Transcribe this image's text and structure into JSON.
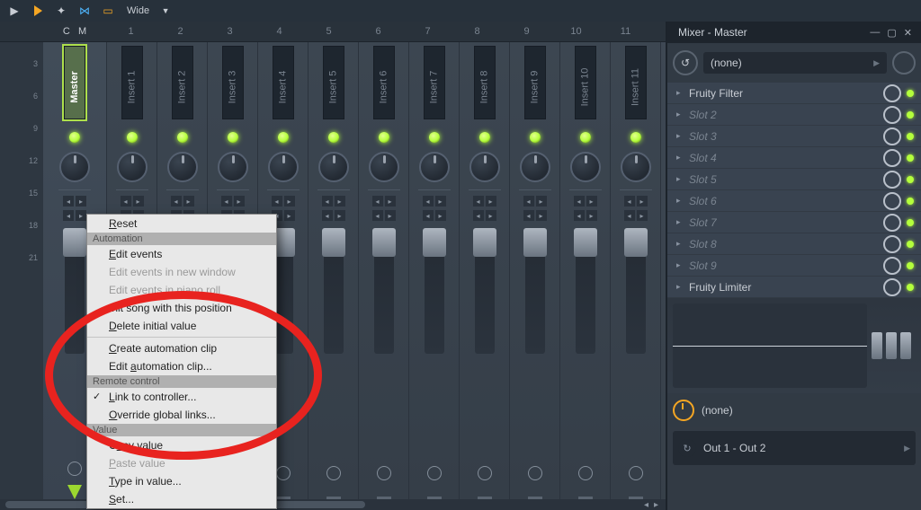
{
  "toolbar": {
    "wide_label": "Wide"
  },
  "headers": {
    "c": "C",
    "m": "M",
    "nums": [
      "1",
      "2",
      "3",
      "4",
      "5",
      "6",
      "7",
      "8",
      "9",
      "10",
      "11"
    ]
  },
  "ruler": [
    "3",
    "6",
    "9",
    "12",
    "15",
    "18",
    "21"
  ],
  "tracks": [
    {
      "name": "Master",
      "master": true
    },
    {
      "name": "Insert 1"
    },
    {
      "name": "Insert 2"
    },
    {
      "name": "Insert 3"
    },
    {
      "name": "Insert 4"
    },
    {
      "name": "Insert 5"
    },
    {
      "name": "Insert 6"
    },
    {
      "name": "Insert 7"
    },
    {
      "name": "Insert 8"
    },
    {
      "name": "Insert 9"
    },
    {
      "name": "Insert 10"
    },
    {
      "name": "Insert 11"
    }
  ],
  "sidepanel": {
    "title": "Mixer - Master",
    "preset": "(none)",
    "slots": [
      {
        "name": "Fruity Filter",
        "filled": true
      },
      {
        "name": "Slot 2",
        "filled": false
      },
      {
        "name": "Slot 3",
        "filled": false
      },
      {
        "name": "Slot 4",
        "filled": false
      },
      {
        "name": "Slot 5",
        "filled": false
      },
      {
        "name": "Slot 6",
        "filled": false
      },
      {
        "name": "Slot 7",
        "filled": false
      },
      {
        "name": "Slot 8",
        "filled": false
      },
      {
        "name": "Slot 9",
        "filled": false
      },
      {
        "name": "Fruity Limiter",
        "filled": true
      }
    ],
    "time_label": "(none)",
    "output_label": "Out 1 - Out 2"
  },
  "context_menu": {
    "items": [
      {
        "type": "item",
        "label": "Reset",
        "u": "R"
      },
      {
        "type": "section",
        "label": "Automation"
      },
      {
        "type": "item",
        "label": "Edit events",
        "u": "E"
      },
      {
        "type": "item",
        "label": "Edit events in new window",
        "disabled": true
      },
      {
        "type": "item",
        "label": "Edit events in piano roll",
        "disabled": true
      },
      {
        "type": "item",
        "label": "Init song with this position"
      },
      {
        "type": "item",
        "label": "Delete initial value",
        "u": "D"
      },
      {
        "type": "sep"
      },
      {
        "type": "item",
        "label": "Create automation clip",
        "u": "C"
      },
      {
        "type": "item",
        "label": "Edit automation clip...",
        "u": "a"
      },
      {
        "type": "section",
        "label": "Remote control"
      },
      {
        "type": "item",
        "label": "Link to controller...",
        "u": "L",
        "check": true
      },
      {
        "type": "item",
        "label": "Override global links...",
        "u": "O"
      },
      {
        "type": "section",
        "label": "Value"
      },
      {
        "type": "item",
        "label": "Copy value",
        "u": "o"
      },
      {
        "type": "item",
        "label": "Paste value",
        "u": "P",
        "disabled": true
      },
      {
        "type": "item",
        "label": "Type in value...",
        "u": "T"
      },
      {
        "type": "item",
        "label": "Set...",
        "u": "S"
      }
    ]
  }
}
